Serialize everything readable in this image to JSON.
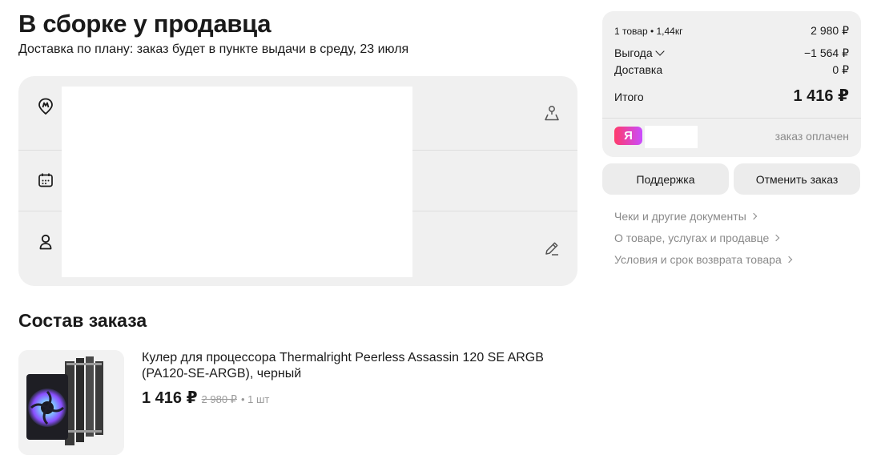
{
  "header": {
    "title": "В сборке у продавца",
    "subtitle": "Доставка по плану: заказ будет в пункте выдачи в среду, 23 июля"
  },
  "info_card": {
    "rows": [
      {
        "icon": "pickup-point-icon",
        "action_icon": "map-person-icon"
      },
      {
        "icon": "calendar-icon"
      },
      {
        "icon": "recipient-icon",
        "action_icon": "edit-icon"
      }
    ]
  },
  "order": {
    "section_title": "Состав заказа",
    "items": [
      {
        "name": "Кулер для процессора Thermalright Peerless Assassin 120 SE ARGB (PA120-SE-ARGB), черный",
        "price": "1 416 ₽",
        "old_price": "2 980 ₽",
        "qty": "• 1 шт"
      }
    ]
  },
  "summary": {
    "items_info": "1 товар • 1,44кг",
    "items_price": "2 980 ₽",
    "benefit_label": "Выгода",
    "benefit_value": "−1 564 ₽",
    "delivery_label": "Доставка",
    "delivery_value": "0 ₽",
    "total_label": "Итого",
    "total_value": "1 416 ₽",
    "payment_badge": "Я",
    "payment_status": "заказ оплачен",
    "brand_colors": {
      "badge_start": "#ff3b6b",
      "badge_end": "#c94cff"
    }
  },
  "actions": {
    "support_label": "Поддержка",
    "cancel_label": "Отменить заказ"
  },
  "links": [
    "Чеки и другие документы",
    "О товаре, услугах и продавце",
    "Условия и срок возврата товара"
  ]
}
